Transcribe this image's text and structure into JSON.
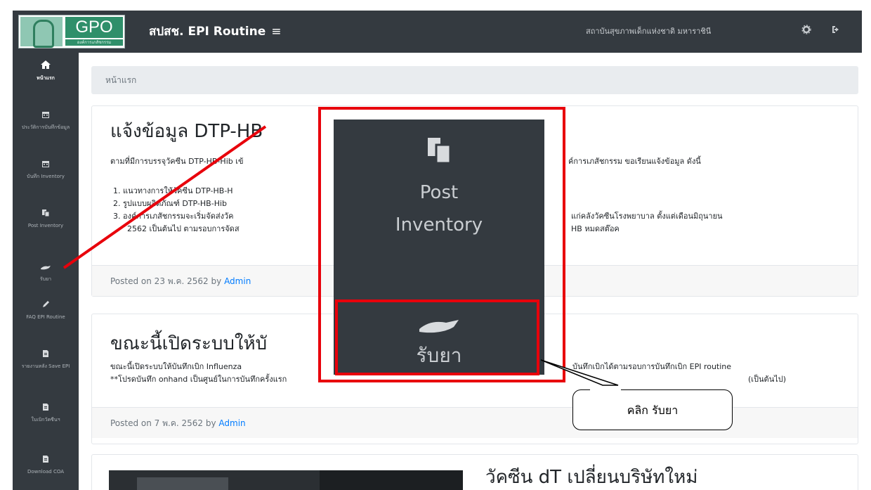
{
  "header": {
    "logo_text": "GPO",
    "logo_subtext": "องค์การเภสัชกรรม",
    "brand": "สปสช. EPI Routine",
    "menu_glyph": "≡",
    "org_name": "สถาบันสุขภาพเด็กแห่งชาติ มหาราชินี",
    "settings_icon": "gear-icon",
    "logout_icon": "sign-out-icon"
  },
  "sidebar": {
    "items": [
      {
        "label": "หน้าแรก",
        "icon": "home-icon",
        "active": true
      },
      {
        "label": "ประวัติการบันทึกข้อมูล",
        "icon": "calendar-icon"
      },
      {
        "label": "บันทึก Inventory",
        "icon": "calendar-icon"
      },
      {
        "label": "Post Inventory",
        "icon": "copy-icon"
      },
      {
        "label": "รับยา",
        "icon": "hand-icon"
      },
      {
        "label": "FAQ EPI Routine",
        "icon": "edit-icon"
      },
      {
        "label": "รายงานหลัง Save EPI",
        "icon": "file-icon"
      },
      {
        "label": "ใบเบิกวัคซีนฯ",
        "icon": "file-icon"
      },
      {
        "label": "Download COA",
        "icon": "file-icon"
      }
    ]
  },
  "breadcrumb": "หน้าแรก",
  "posts": [
    {
      "title": "แจ้งข้อมูล DTP-HB",
      "body": "ตามที่มีการบรรจุวัคซีน DTP-HB-Hib เข้",
      "body_right": "ค์การเภสัชกรรม ขอเรียนแจ้งข้อมูล ดังนี้",
      "list": [
        "1. แนวทางการให้วัคซีน DTP-HB-H",
        "2. รูปแบบผลิตภัณฑ์ DTP-HB-Hib",
        "3. องค์การเภสัชกรรมจะเริ่มจัดส่งวัค"
      ],
      "list_right": "แก่คลังวัคซีนโรงพยาบาล ตั้งแต่เดือนมิถุนายน",
      "list_cont": "2562 เป็นต้นไป ตามรอบการจัดส",
      "list_cont_right": "HB หมดสต๊อค",
      "footer_prefix": "Posted on 23 พ.ค. 2562 by",
      "author": "Admin"
    },
    {
      "title": "ขณะนี้เปิดระบบให้บั",
      "body": "ขณะนี้เปิดระบบให้บันทึกเบิก Influenza",
      "body_right": "บันทึกเบิกได้ตามรอบการบันทึกเบิก EPI routine",
      "body2": "**โปรดบันทึก onhand เป็นศูนย์ในการบันทึกครั้งแรก",
      "body2_right": "(เป็นต้นไป)",
      "footer_prefix": "Posted on 7 พ.ค. 2562 by",
      "author": "Admin"
    },
    {
      "title": "วัคซีน dT เปลี่ยนบริษัทใหม่"
    }
  ],
  "zoom": {
    "icon": "copy-icon",
    "label_line1": "Post",
    "label_line2": "Inventory",
    "rub_icon": "hand-icon",
    "rub_label": "รับยา"
  },
  "callout": {
    "text": "คลิก รับยา"
  },
  "colors": {
    "navbar": "#343a40",
    "highlight": "#e8000b",
    "link": "#007bff"
  }
}
